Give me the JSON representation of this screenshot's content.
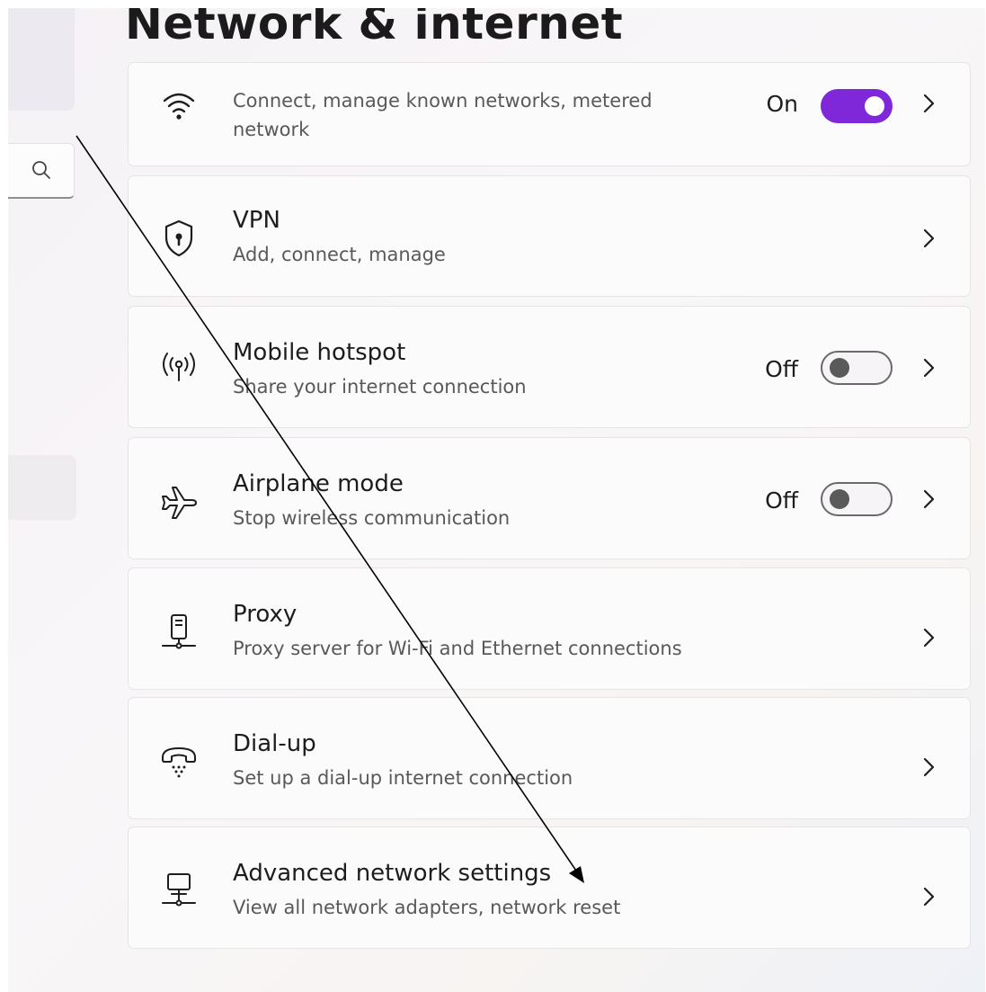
{
  "page": {
    "title": "Network & internet"
  },
  "sidebar": {
    "search_icon": "search-icon"
  },
  "cards": [
    {
      "id": "wifi",
      "icon": "wifi-icon",
      "title": "",
      "description": "Connect, manage known networks, metered network",
      "state": "On",
      "toggle": true
    },
    {
      "id": "vpn",
      "icon": "shield-lock-icon",
      "title": "VPN",
      "description": "Add, connect, manage",
      "state": "",
      "toggle": null
    },
    {
      "id": "mobile-hotspot",
      "icon": "hotspot-icon",
      "title": "Mobile hotspot",
      "description": "Share your internet connection",
      "state": "Off",
      "toggle": false
    },
    {
      "id": "airplane-mode",
      "icon": "airplane-icon",
      "title": "Airplane mode",
      "description": "Stop wireless communication",
      "state": "Off",
      "toggle": false
    },
    {
      "id": "proxy",
      "icon": "proxy-server-icon",
      "title": "Proxy",
      "description": "Proxy server for Wi-Fi and Ethernet connections",
      "state": "",
      "toggle": null
    },
    {
      "id": "dial-up",
      "icon": "dial-up-phone-icon",
      "title": "Dial-up",
      "description": "Set up a dial-up internet connection",
      "state": "",
      "toggle": null
    },
    {
      "id": "advanced",
      "icon": "network-computer-icon",
      "title": "Advanced network settings",
      "description": "View all network adapters, network reset",
      "state": "",
      "toggle": null
    }
  ],
  "colors": {
    "accent": "#7f28d9",
    "annotation_arrow": "#000000"
  }
}
